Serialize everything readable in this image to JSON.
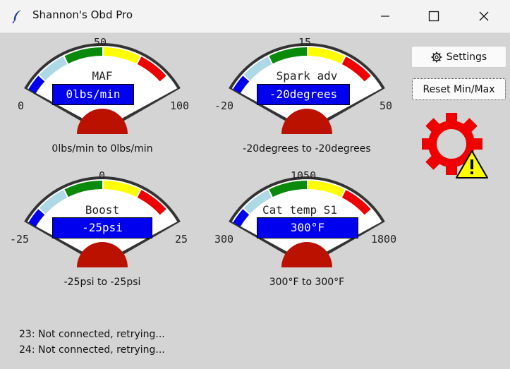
{
  "window": {
    "title": "Shannon's Obd Pro"
  },
  "controls": {
    "settings_label": "Settings",
    "reset_label": "Reset Min/Max"
  },
  "gauges": [
    {
      "title": "MAF",
      "value": "0lbs/min",
      "min": "0",
      "mid": "50",
      "max": "100",
      "range_text": "0lbs/min  to 0lbs/min"
    },
    {
      "title": "Spark adv",
      "value": "-20degrees",
      "min": "-20",
      "mid": "15",
      "max": "50",
      "range_text": "-20degrees to -20degrees"
    },
    {
      "title": "Boost",
      "value": "-25psi",
      "min": "-25",
      "mid": "0",
      "max": "25",
      "range_text": "-25psi  to -25psi"
    },
    {
      "title": "Cat temp S1",
      "value": "300°F",
      "min": "300",
      "mid": "1050",
      "max": "1800",
      "range_text": "300°F  to 300°F"
    }
  ],
  "status_lines": [
    "23: Not connected, retrying...",
    "24: Not connected, retrying..."
  ],
  "colors": {
    "blue": "#0000ee",
    "light_blue": "#add8e6",
    "green": "#0a8a0a",
    "yellow": "#ffff00",
    "red": "#ee0000",
    "dial": "#bb1100"
  }
}
